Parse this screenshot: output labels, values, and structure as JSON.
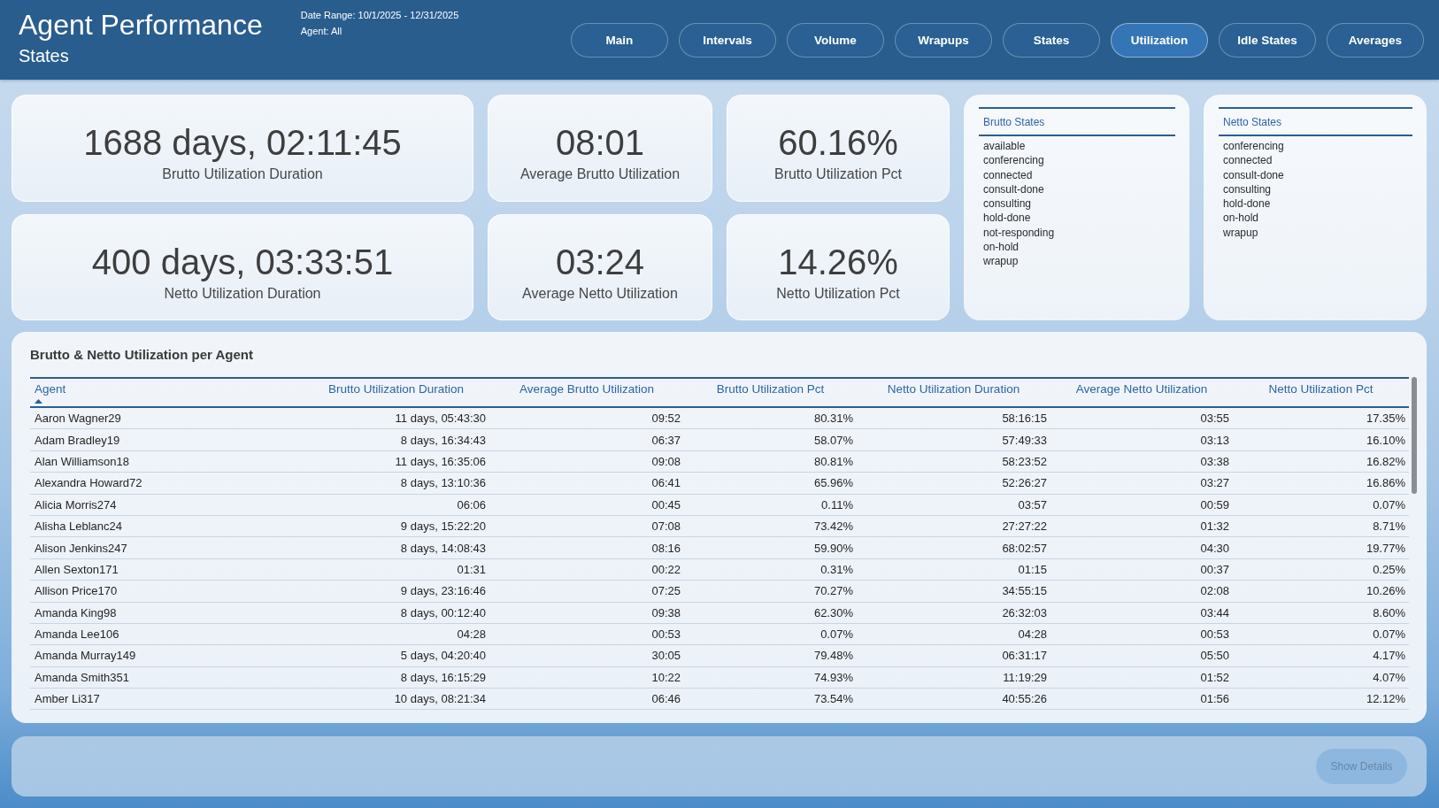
{
  "header": {
    "title": "Agent Performance",
    "subtitle": "States",
    "date_range": "Date Range: 10/1/2025 - 12/31/2025",
    "agent_filter": "Agent: All"
  },
  "nav": [
    {
      "label": "Main",
      "selected": false
    },
    {
      "label": "Intervals",
      "selected": false
    },
    {
      "label": "Volume",
      "selected": false
    },
    {
      "label": "Wrapups",
      "selected": false
    },
    {
      "label": "States",
      "selected": false
    },
    {
      "label": "Utilization",
      "selected": true
    },
    {
      "label": "Idle States",
      "selected": false
    },
    {
      "label": "Averages",
      "selected": false
    }
  ],
  "kpi_cards": [
    {
      "value": "1688 days, 02:11:45",
      "label": "Brutto Utilization Duration"
    },
    {
      "value": "08:01",
      "label": "Average Brutto Utilization"
    },
    {
      "value": "60.16%",
      "label": "Brutto Utilization Pct"
    },
    {
      "value": "400 days, 03:33:51",
      "label": "Netto Utilization Duration"
    },
    {
      "value": "03:24",
      "label": "Average Netto Utilization"
    },
    {
      "value": "14.26%",
      "label": "Netto Utilization Pct"
    }
  ],
  "state_lists": [
    {
      "title": "Brutto States",
      "items": [
        "available",
        "conferencing",
        "connected",
        "consult-done",
        "consulting",
        "hold-done",
        "not-responding",
        "on-hold",
        "wrapup"
      ]
    },
    {
      "title": "Netto States",
      "items": [
        "conferencing",
        "connected",
        "consult-done",
        "consulting",
        "hold-done",
        "on-hold",
        "wrapup"
      ]
    }
  ],
  "table": {
    "title": "Brutto & Netto Utilization per Agent",
    "columns": [
      {
        "label": "Agent",
        "sorted": true
      },
      {
        "label": "Brutto Utilization Duration",
        "sorted": false
      },
      {
        "label": "Average Brutto Utilization",
        "sorted": false
      },
      {
        "label": "Brutto Utilization Pct",
        "sorted": false
      },
      {
        "label": "Netto Utilization Duration",
        "sorted": false
      },
      {
        "label": "Average Netto Utilization",
        "sorted": false
      },
      {
        "label": "Netto Utilization Pct",
        "sorted": false
      }
    ],
    "rows": [
      [
        "Aaron Wagner29",
        "11 days, 05:43:30",
        "09:52",
        "80.31%",
        "58:16:15",
        "03:55",
        "17.35%"
      ],
      [
        "Adam Bradley19",
        "8 days, 16:34:43",
        "06:37",
        "58.07%",
        "57:49:33",
        "03:13",
        "16.10%"
      ],
      [
        "Alan Williamson18",
        "11 days, 16:35:06",
        "09:08",
        "80.81%",
        "58:23:52",
        "03:38",
        "16.82%"
      ],
      [
        "Alexandra Howard72",
        "8 days, 13:10:36",
        "06:41",
        "65.96%",
        "52:26:27",
        "03:27",
        "16.86%"
      ],
      [
        "Alicia Morris274",
        "06:06",
        "00:45",
        "0.11%",
        "03:57",
        "00:59",
        "0.07%"
      ],
      [
        "Alisha Leblanc24",
        "9 days, 15:22:20",
        "07:08",
        "73.42%",
        "27:27:22",
        "01:32",
        "8.71%"
      ],
      [
        "Alison Jenkins247",
        "8 days, 14:08:43",
        "08:16",
        "59.90%",
        "68:02:57",
        "04:30",
        "19.77%"
      ],
      [
        "Allen Sexton171",
        "01:31",
        "00:22",
        "0.31%",
        "01:15",
        "00:37",
        "0.25%"
      ],
      [
        "Allison Price170",
        "9 days, 23:16:46",
        "07:25",
        "70.27%",
        "34:55:15",
        "02:08",
        "10.26%"
      ],
      [
        "Amanda King98",
        "8 days, 00:12:40",
        "09:38",
        "62.30%",
        "26:32:03",
        "03:44",
        "8.60%"
      ],
      [
        "Amanda Lee106",
        "04:28",
        "00:53",
        "0.07%",
        "04:28",
        "00:53",
        "0.07%"
      ],
      [
        "Amanda Murray149",
        "5 days, 04:20:40",
        "30:05",
        "79.48%",
        "06:31:17",
        "05:50",
        "4.17%"
      ],
      [
        "Amanda Smith351",
        "8 days, 16:15:29",
        "10:22",
        "74.93%",
        "11:19:29",
        "01:52",
        "4.07%"
      ],
      [
        "Amber Li317",
        "10 days, 08:21:34",
        "06:46",
        "73.54%",
        "40:55:26",
        "01:56",
        "12.12%"
      ]
    ]
  },
  "footer": {
    "show_details": {
      "label": "Show Details",
      "disabled": true
    }
  }
}
